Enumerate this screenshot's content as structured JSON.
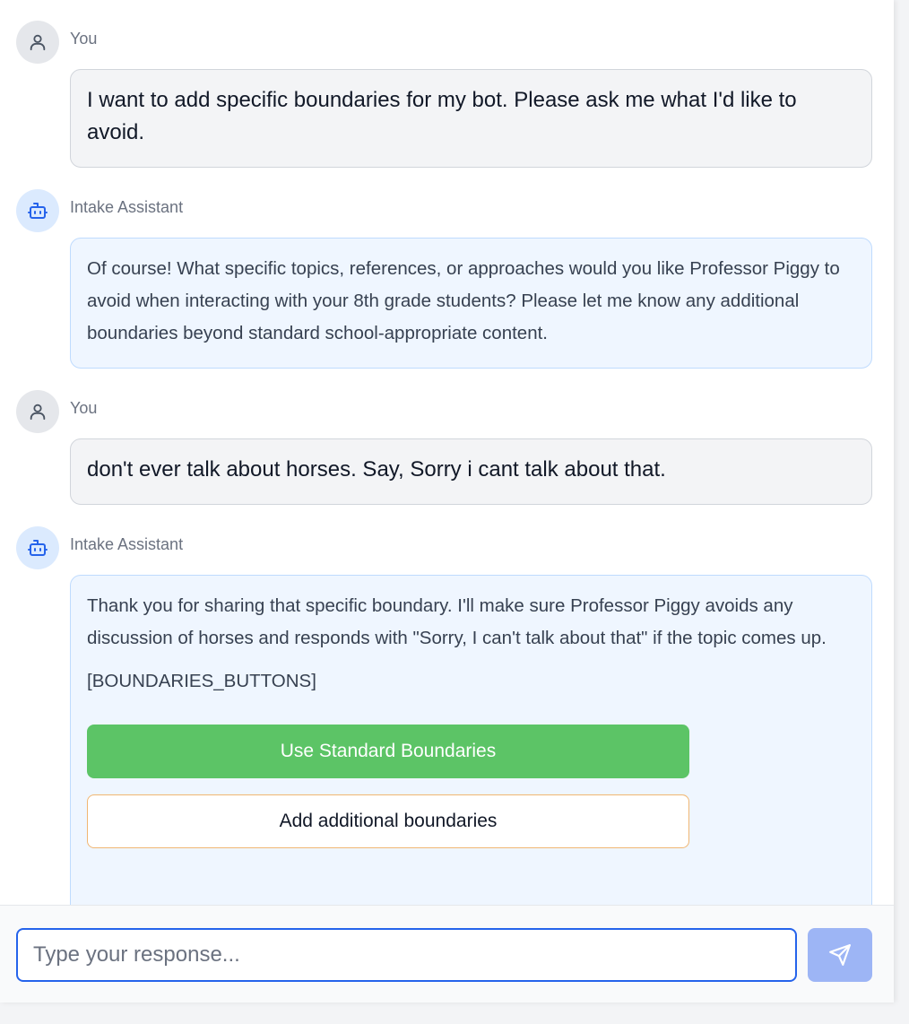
{
  "messages": [
    {
      "role": "user",
      "sender": "You",
      "paragraphs": [
        "I want to add specific boundaries for my bot. Please ask me what I'd like to avoid."
      ]
    },
    {
      "role": "assistant",
      "sender": "Intake Assistant",
      "paragraphs": [
        "Of course! What specific topics, references, or approaches would you like Professor Piggy to avoid when interacting with your 8th grade students? Please let me know any additional boundaries beyond standard school-appropriate content."
      ]
    },
    {
      "role": "user",
      "sender": "You",
      "paragraphs": [
        "don't ever talk about horses. Say, Sorry i cant talk about that."
      ]
    },
    {
      "role": "assistant",
      "sender": "Intake Assistant",
      "paragraphs": [
        "Thank you for sharing that specific boundary. I'll make sure Professor Piggy avoids any discussion of horses and responds with \"Sorry, I can't talk about that\" if the topic comes up.",
        "[BOUNDARIES_BUTTONS]"
      ],
      "buttons": {
        "primary": "Use Standard Boundaries",
        "secondary": "Add additional boundaries"
      }
    }
  ],
  "composer": {
    "placeholder": "Type your response...",
    "value": ""
  },
  "icons": {
    "user_avatar": "user-icon",
    "assistant_avatar": "bot-icon",
    "send": "send-icon"
  },
  "colors": {
    "primary_button": "#5cc466",
    "secondary_button_border": "#f0b672",
    "assistant_bubble": "#eff6ff",
    "user_bubble": "#f3f4f6",
    "send_button": "#9db5f5",
    "input_focus_border": "#2563eb"
  }
}
